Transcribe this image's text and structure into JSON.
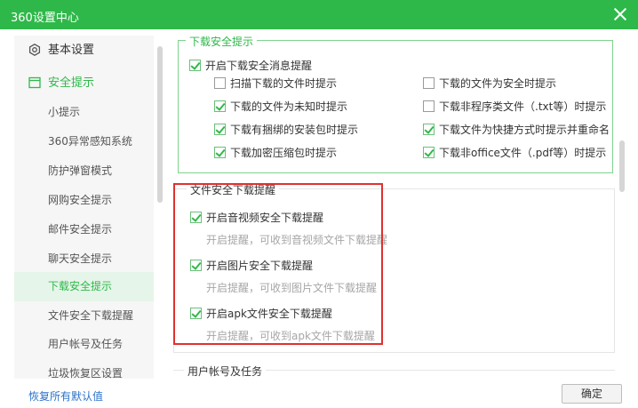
{
  "window": {
    "title": "360设置中心"
  },
  "sidebar": {
    "items": [
      {
        "label": "基本设置"
      },
      {
        "label": "安全提示"
      },
      {
        "label": "小提示"
      },
      {
        "label": "360异常感知系统"
      },
      {
        "label": "防护弹窗模式"
      },
      {
        "label": "网购安全提示"
      },
      {
        "label": "邮件安全提示"
      },
      {
        "label": "聊天安全提示"
      },
      {
        "label": "下载安全提示"
      },
      {
        "label": "文件安全下载提醒"
      },
      {
        "label": "用户帐号及任务"
      },
      {
        "label": "垃圾恢复区设置"
      }
    ]
  },
  "download_safety": {
    "title": "下载安全提示",
    "enable": {
      "label": "开启下载安全消息提醒",
      "checked": true
    },
    "options": [
      {
        "label": "扫描下载的文件时提示",
        "checked": false
      },
      {
        "label": "下载的文件为安全时提示",
        "checked": false
      },
      {
        "label": "下载的文件为未知时提示",
        "checked": true
      },
      {
        "label": "下载非程序类文件（.txt等）时提示",
        "checked": false
      },
      {
        "label": "下载有捆绑的安装包时提示",
        "checked": true
      },
      {
        "label": "下载文件为快捷方式时提示并重命名",
        "checked": true
      },
      {
        "label": "下载加密压缩包时提示",
        "checked": true
      },
      {
        "label": "下载非office文件（.pdf等）时提示",
        "checked": true
      }
    ]
  },
  "file_download": {
    "title": "文件安全下载提醒",
    "options": [
      {
        "label": "开启音视频安全下载提醒",
        "checked": true,
        "hint": "开启提醒，可收到音视频文件下载提醒"
      },
      {
        "label": "开启图片安全下载提醒",
        "checked": true,
        "hint": "开启提醒，可收到图片文件下载提醒"
      },
      {
        "label": "开启apk文件安全下载提醒",
        "checked": true,
        "hint": "开启提醒，可收到apk文件下载提醒"
      }
    ]
  },
  "user_account": {
    "title": "用户帐号及任务"
  },
  "footer": {
    "restore_label": "恢复所有默认值",
    "confirm_label": "确定"
  },
  "colors": {
    "accent": "#2fb84a",
    "highlight_box": "#e0312f",
    "link": "#2b72c9"
  }
}
